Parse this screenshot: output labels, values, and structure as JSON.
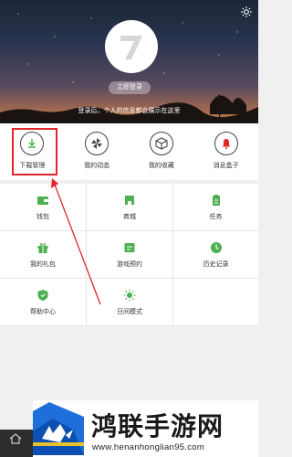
{
  "header": {
    "login_label": "立即登录",
    "hint": "登录后，个人的信息都会展示在这里"
  },
  "quick_nav": [
    {
      "label": "下载管理",
      "icon": "download-icon"
    },
    {
      "label": "我的动态",
      "icon": "pinwheel-icon"
    },
    {
      "label": "我的收藏",
      "icon": "box-icon"
    },
    {
      "label": "消息盒子",
      "icon": "bell-icon"
    }
  ],
  "grid": [
    {
      "label": "钱包",
      "icon": "wallet-icon"
    },
    {
      "label": "商城",
      "icon": "shop-icon"
    },
    {
      "label": "任务",
      "icon": "task-icon"
    },
    {
      "label": "我的礼包",
      "icon": "gift-icon"
    },
    {
      "label": "游戏预约",
      "icon": "reserve-icon"
    },
    {
      "label": "历史记录",
      "icon": "clock-icon"
    },
    {
      "label": "帮助中心",
      "icon": "shield-icon"
    },
    {
      "label": "日间模式",
      "icon": "sun-icon"
    }
  ],
  "banner": {
    "brand": "鸿联手游网",
    "url": "www.henanhonglian95.com"
  },
  "colors": {
    "accent": "#4caf50",
    "highlight": "#e3262a"
  }
}
